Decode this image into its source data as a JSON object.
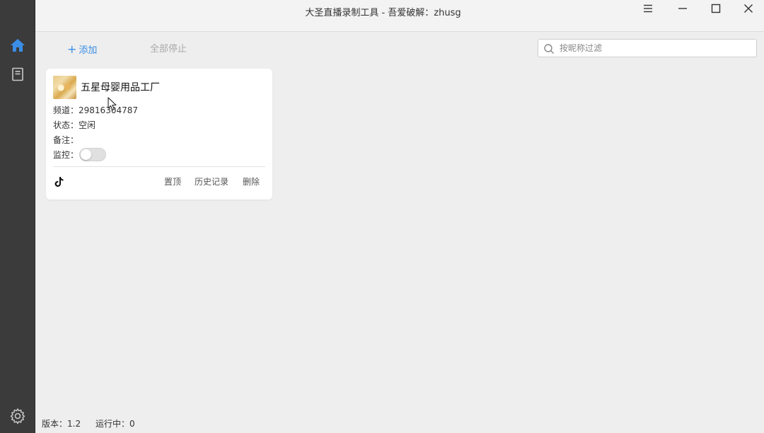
{
  "window": {
    "title": "大圣直播录制工具 - 吾爱破解：zhusg",
    "controls": [
      "menu-icon",
      "minimize-icon",
      "maximize-icon",
      "close-icon"
    ]
  },
  "sidebar": {
    "items": [
      {
        "icon": "home-icon",
        "active": true
      },
      {
        "icon": "book-icon",
        "active": false
      }
    ],
    "bottom_icon": "gear-icon"
  },
  "toolbar": {
    "add_plus": "+",
    "add_label": "添加",
    "stop_all_label": "全部停止"
  },
  "search": {
    "placeholder": "按昵称过滤",
    "value": ""
  },
  "card": {
    "name": "五星母婴用品工厂",
    "channel_label": "频道：",
    "channel_value": "29816304787",
    "status_label": "状态：",
    "status_value": "空闲",
    "remark_label": "备注：",
    "remark_value": "",
    "monitor_label": "监控：",
    "monitor_on": false,
    "platform_icon": "tiktok-icon",
    "actions": {
      "pin": "置顶",
      "history": "历史记录",
      "delete": "删除"
    }
  },
  "statusbar": {
    "version": "版本：1.2",
    "running": "运行中：0"
  },
  "colors": {
    "accent": "#3a8ee6",
    "sidebar_bg": "#3b3b3b",
    "content_bg": "#eeeeee"
  }
}
